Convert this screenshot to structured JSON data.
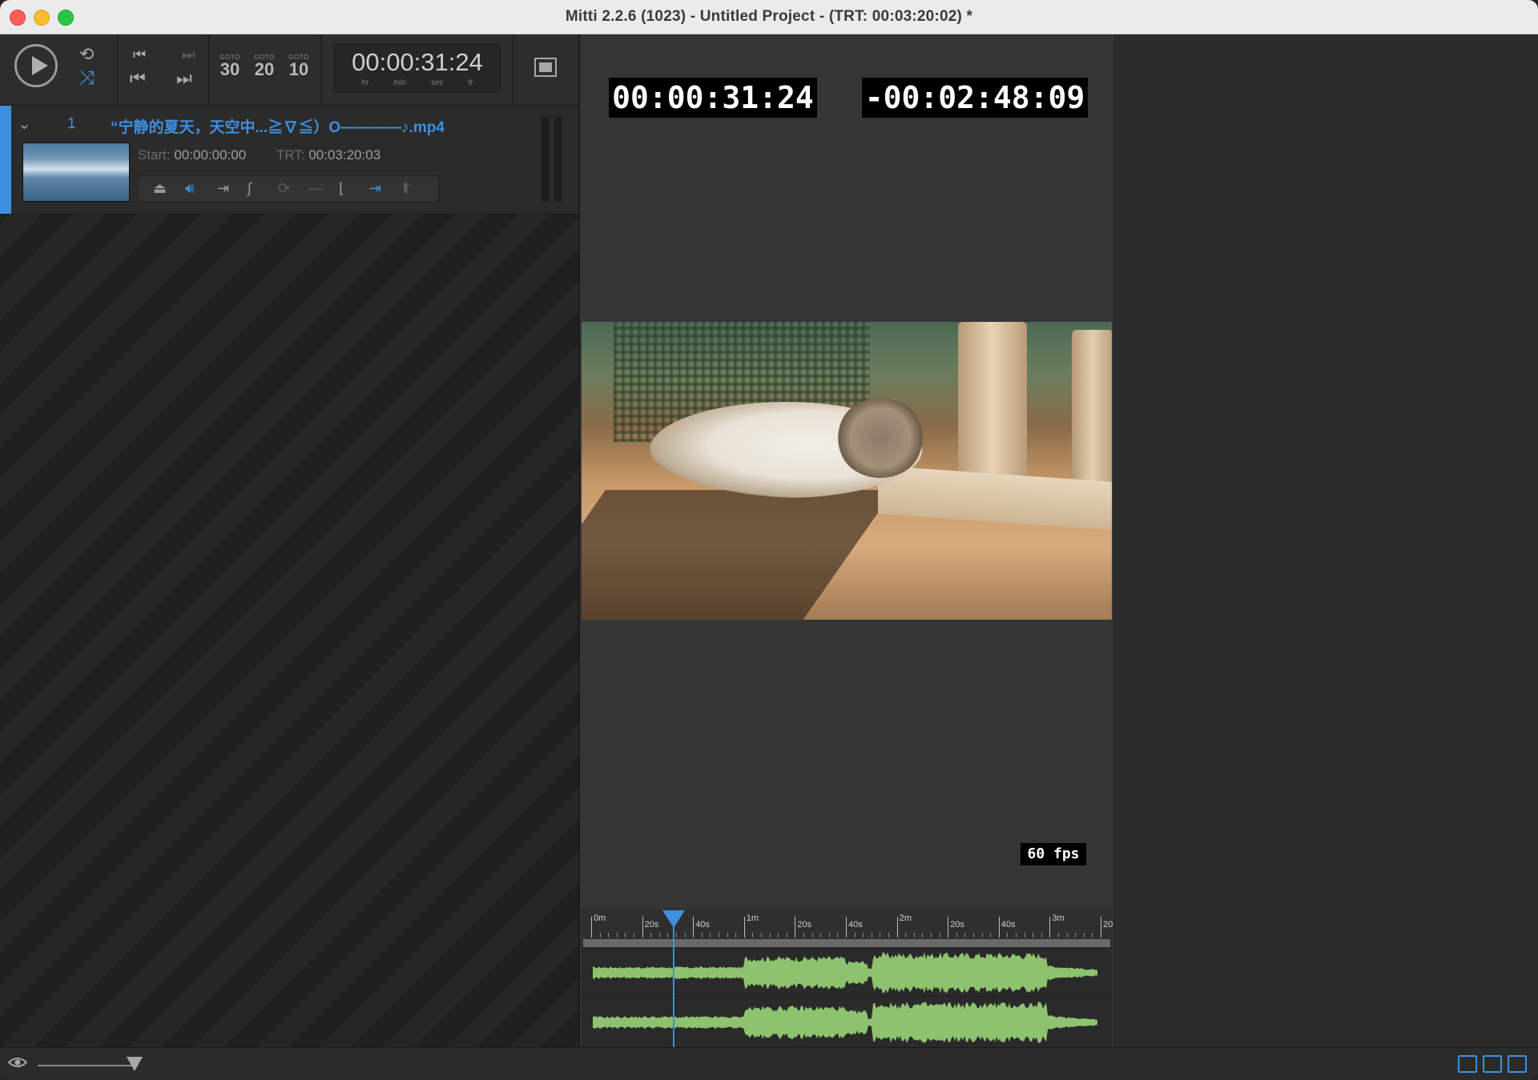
{
  "window": {
    "title": "Mitti 2.2.6 (1023) - Untitled Project - (TRT: 00:03:20:02) *"
  },
  "transport": {
    "goto": [
      {
        "label": "GOTO",
        "value": "30"
      },
      {
        "label": "GOTO",
        "value": "20"
      },
      {
        "label": "GOTO",
        "value": "10"
      }
    ],
    "timecode": "00:00:31:24",
    "units": [
      "hr",
      "min",
      "sec",
      "fr"
    ]
  },
  "cue": {
    "number": "1",
    "title": "“宁静的夏天，天空中...≧∇≦）O————♪.mp4",
    "start_label": "Start:",
    "start_value": "00:00:00:00",
    "trt_label": "TRT:",
    "trt_value": "00:03:20:03"
  },
  "preview": {
    "elapsed": "00:00:31:24",
    "remaining": "-00:02:48:09",
    "fps": "60 fps"
  },
  "timeline": {
    "ruler_labels": [
      "0m",
      "20s",
      "40s",
      "1m",
      "20s",
      "40s",
      "2m",
      "20s",
      "40s",
      "3m",
      "20"
    ],
    "playhead_fraction": 0.159
  },
  "colors": {
    "accent": "#3d8fe0",
    "waveform": "#8dc26f",
    "window_bg": "#2b2b2b"
  },
  "icons": {
    "play": "play-icon",
    "loop": "loop-icon",
    "shuffle": "shuffle-icon",
    "prev": "previous-cue-icon",
    "next": "next-cue-icon",
    "fullscreen": "fullscreen-icon",
    "eye": "eye-icon"
  }
}
